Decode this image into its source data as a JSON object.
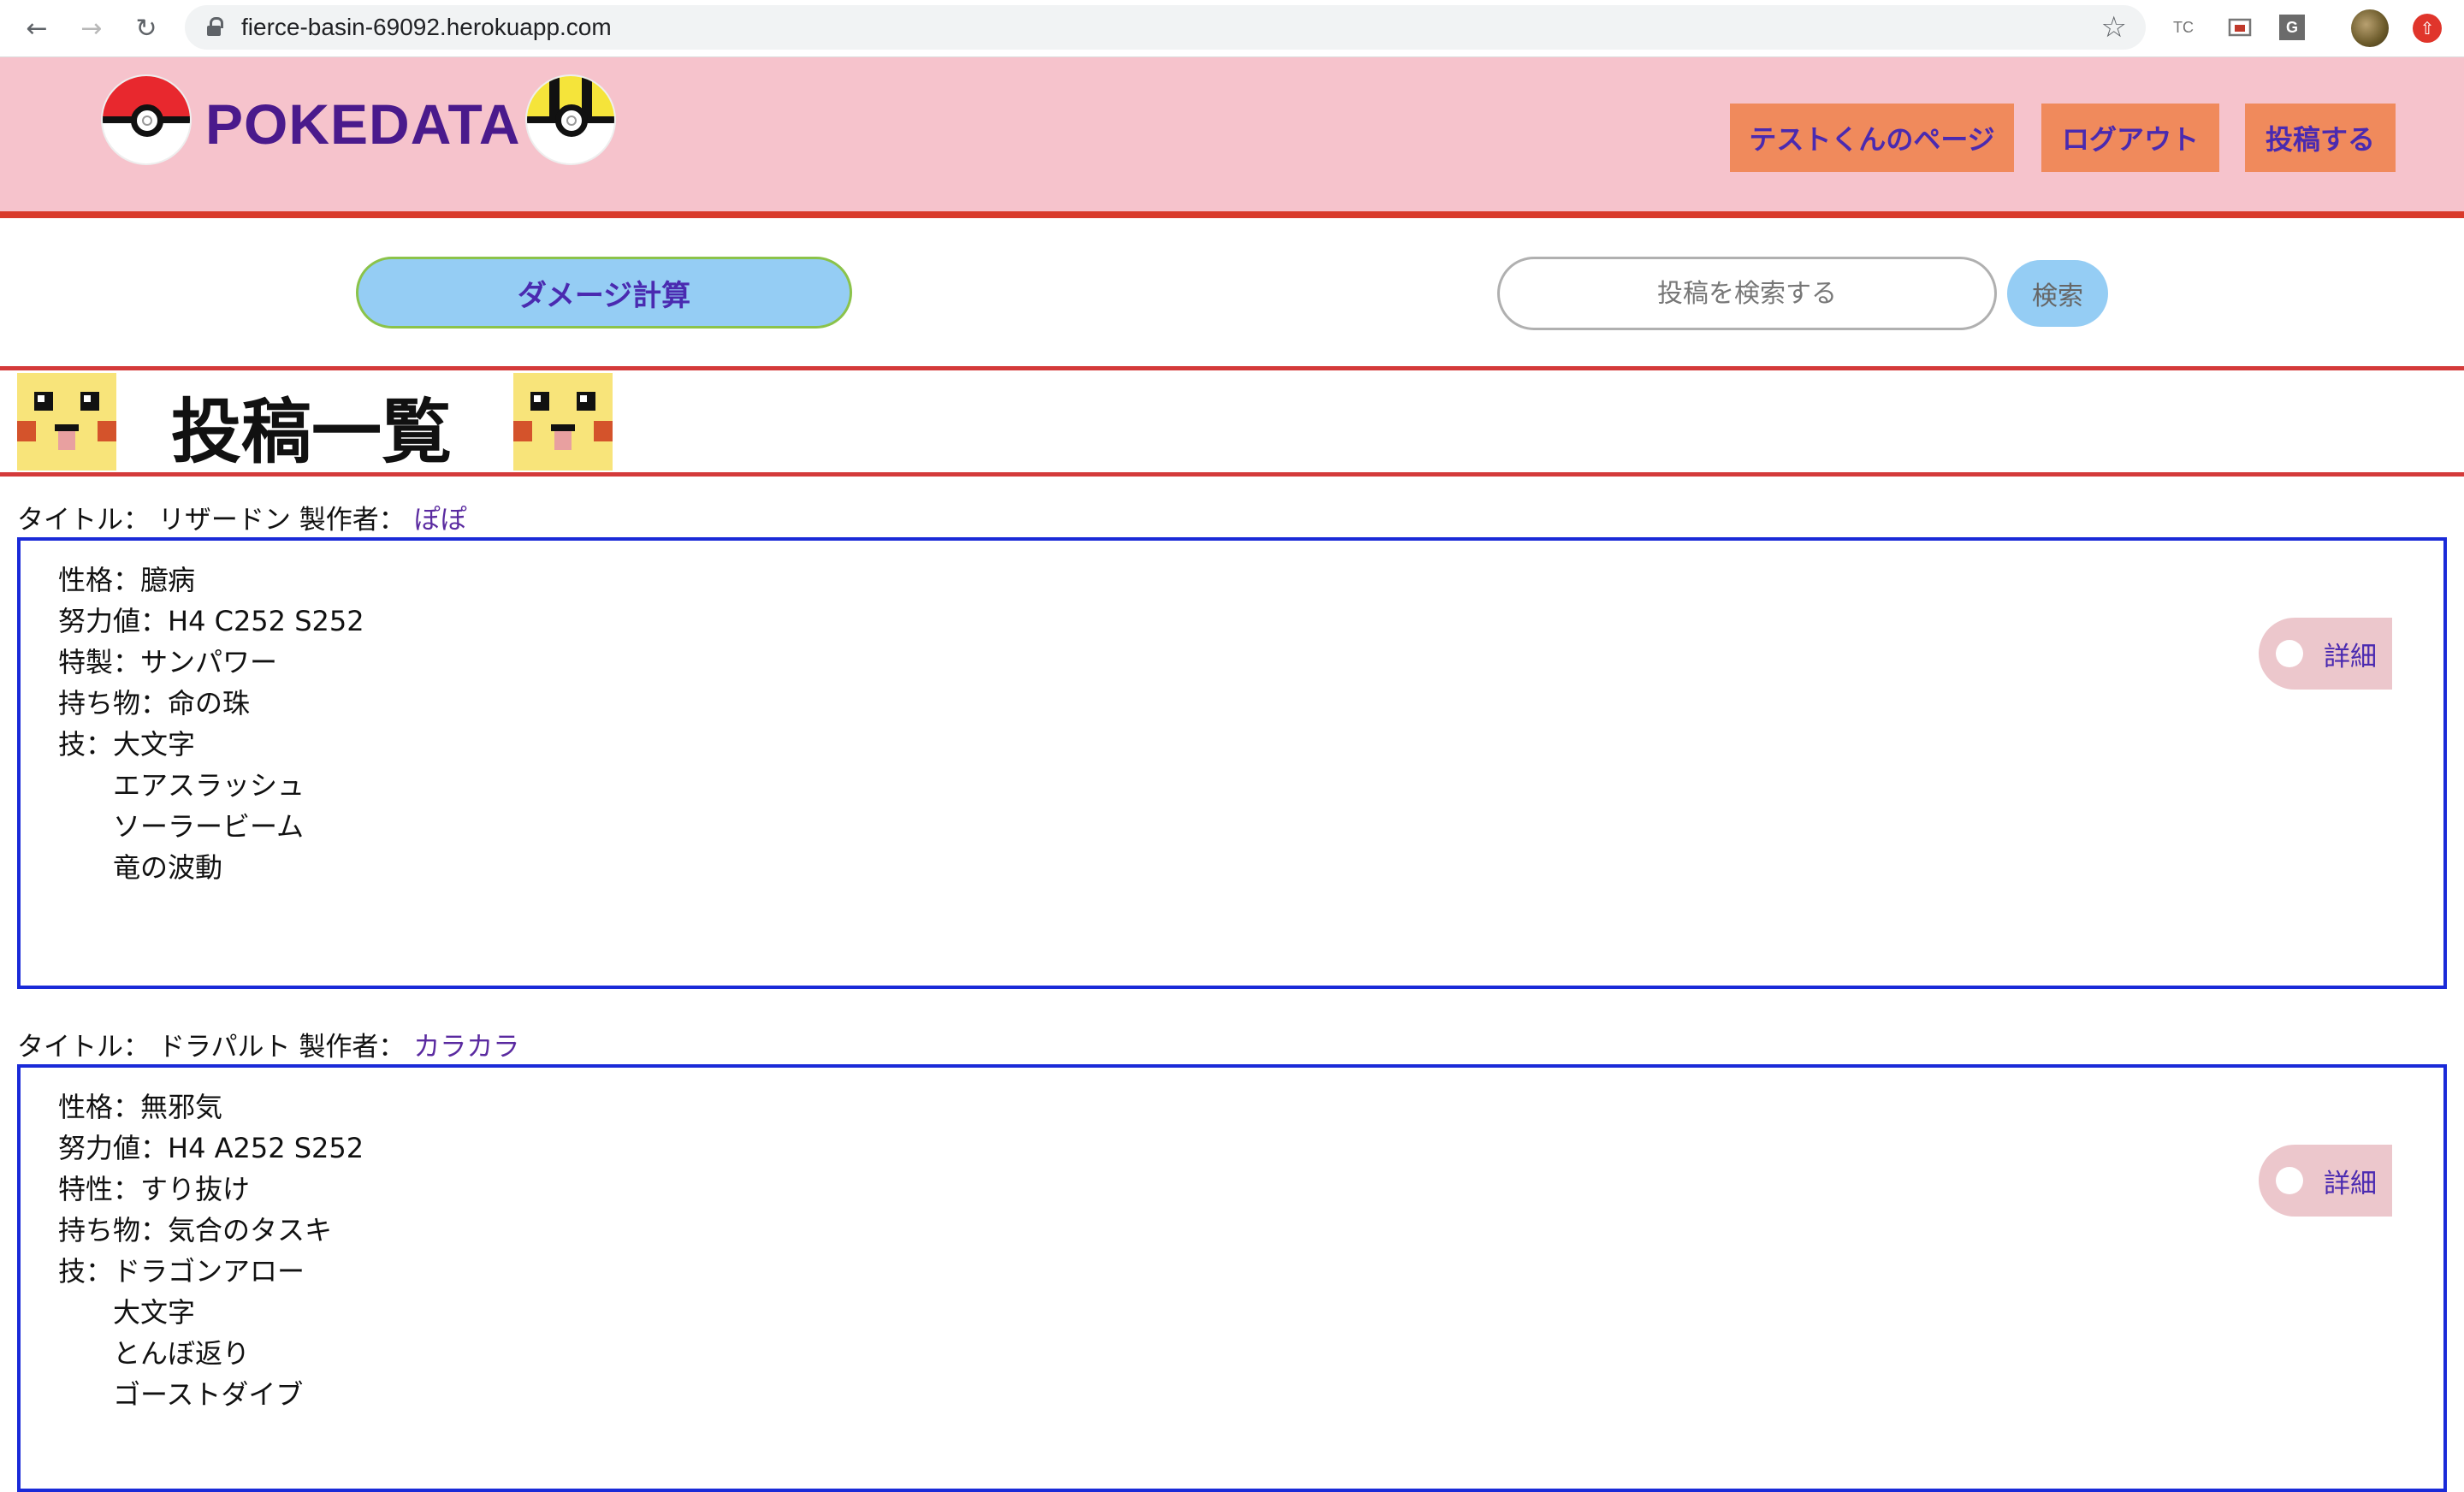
{
  "browser": {
    "url": "fierce-basin-69092.herokuapp.com",
    "extension_tc": "TC",
    "extension_g": "G"
  },
  "header": {
    "brand": "POKEDATA",
    "nav": [
      {
        "label": "テストくんのページ"
      },
      {
        "label": "ログアウト"
      },
      {
        "label": "投稿する"
      }
    ]
  },
  "tools": {
    "damage_calc_label": "ダメージ計算",
    "search_placeholder": "投稿を検索する",
    "search_button_label": "検索"
  },
  "page_title": "投稿一覧",
  "posts": [
    {
      "title_label": "タイトル：",
      "title": "リザードン",
      "author_label": "製作者：",
      "author": "ぽぽ",
      "lines": [
        "性格：臆病",
        "努力値：H4 C252 S252",
        "特製：サンパワー",
        "持ち物：命の珠",
        "技：大文字"
      ],
      "moves_extra": [
        "エアスラッシュ",
        "ソーラービーム",
        "竜の波動"
      ],
      "detail_label": "詳細"
    },
    {
      "title_label": "タイトル：",
      "title": "ドラパルト",
      "author_label": "製作者：",
      "author": "カラカラ",
      "lines": [
        "性格：無邪気",
        "努力値：H4 A252 S252",
        "特性：すり抜け",
        "持ち物：気合のタスキ",
        "技：ドラゴンアロー"
      ],
      "moves_extra": [
        "大文字",
        "とんぼ返り",
        "ゴーストダイブ"
      ],
      "detail_label": "詳細"
    }
  ]
}
